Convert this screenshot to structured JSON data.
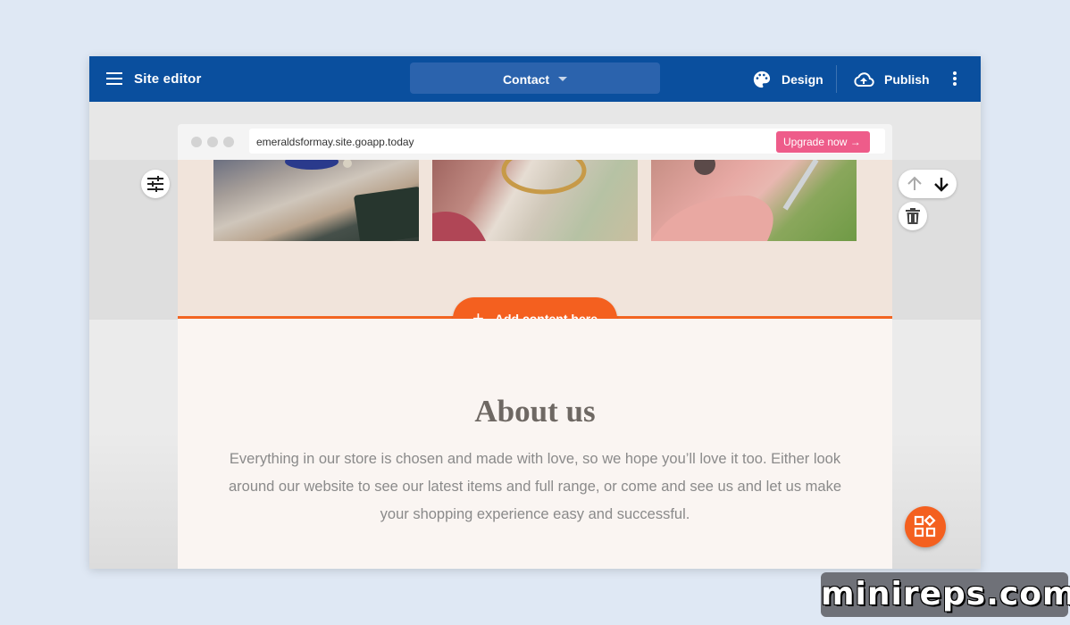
{
  "header": {
    "title": "Site editor",
    "page_selector": "Contact",
    "design_label": "Design",
    "publish_label": "Publish"
  },
  "browser": {
    "url": "emeraldsformay.site.goapp.today",
    "upgrade_label": "Upgrade now →"
  },
  "canvas": {
    "add_content_label": "Add content here"
  },
  "about": {
    "title": "About us",
    "text": "Everything in our store is chosen and made with love, so we hope you’ll love it too. Either look around our website to see our latest items and full range, or come and see us and let us make your shopping experience easy and successful."
  },
  "gallery": {
    "photos": [
      "ring-photo-1",
      "ring-photo-2",
      "ring-photo-3"
    ]
  },
  "icons": {
    "menu": "menu-icon",
    "caret": "caret-down-icon",
    "design": "palette-icon",
    "publish": "cloud-upload-icon",
    "more": "more-vertical-icon",
    "settings": "sliders-icon",
    "up": "arrow-up-icon",
    "down": "arrow-down-icon",
    "delete": "trash-icon",
    "fab": "widgets-icon"
  },
  "colors": {
    "topbar": "#0a4f9e",
    "accent": "#f4601f",
    "upgrade": "#ee5c8a"
  },
  "watermark": "minireps.com"
}
